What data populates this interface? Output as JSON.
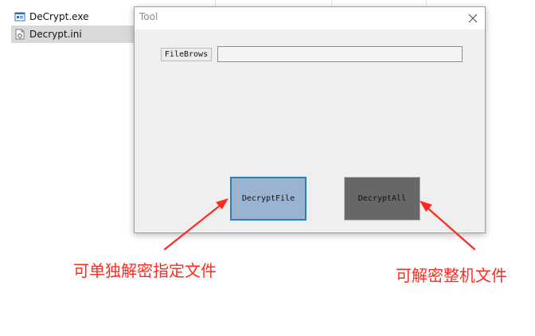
{
  "explorer": {
    "files": [
      {
        "name": "DeCrypt.exe",
        "icon": "executable-file-icon"
      },
      {
        "name": "Decrypt.ini",
        "icon": "settings-file-icon",
        "selected": true
      }
    ]
  },
  "window": {
    "title": "Tool",
    "close_icon": "close-icon",
    "browse_label": "FileBrows",
    "path_value": "",
    "decrypt_file_label": "DecryptFile",
    "decrypt_all_label": "DecryptAll"
  },
  "annotations": {
    "left_note": "可单独解密指定文件",
    "right_note": "可解密整机文件",
    "color": "#ff2a1f"
  },
  "colors": {
    "window_background": "#efefef",
    "decrypt_file_button": "#9ab3d1",
    "decrypt_all_button": "#676767",
    "selection_background": "#d9d9d9"
  }
}
